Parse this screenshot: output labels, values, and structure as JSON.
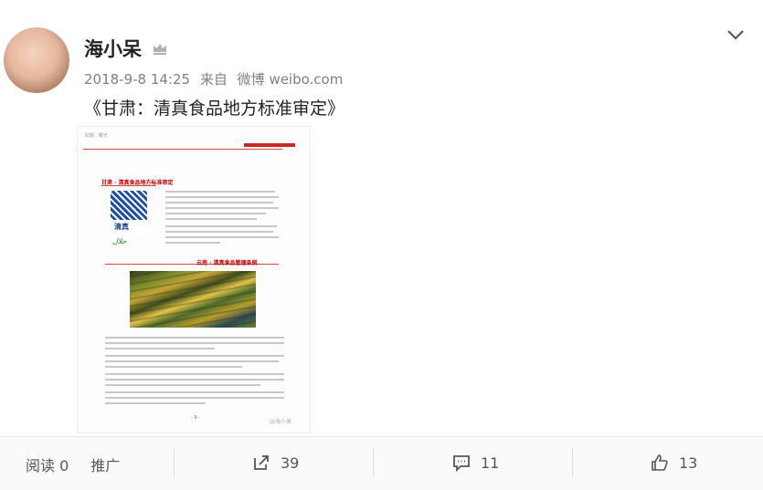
{
  "post": {
    "author": "海小呆",
    "timestamp": "2018-9-8 14:25",
    "source_prefix": "来自",
    "source": "微博 weibo.com",
    "text": "《甘肃：清真食品地方标准审定》"
  },
  "image": {
    "header": "彩题 · 曝光",
    "section1": "甘肃 · 清真食品地方标准审定",
    "section2": "云南 · 清真食品管理条例",
    "seal": "清真",
    "script": "حلال",
    "page_number": "- 9 -",
    "watermark": "@海小呆"
  },
  "actions": {
    "read_label": "阅读 0",
    "promote_label": "推广",
    "repost_count": "39",
    "comment_count": "11",
    "like_count": "13"
  },
  "icons": {
    "vip": "crown-icon",
    "menu": "chevron-down-icon",
    "repost": "share-icon",
    "comment": "comment-icon",
    "like": "thumbs-up-icon"
  }
}
